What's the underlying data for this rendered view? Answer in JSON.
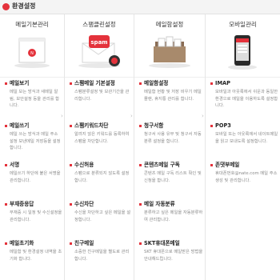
{
  "header": {
    "title": "환경설정"
  },
  "columns": [
    {
      "heading": "메일기본관리",
      "items": [
        {
          "title": "메일보기",
          "desc": "메일 보는 방식과 새메일 알림, 보안설정 등을 관리를 합니다."
        },
        {
          "title": "메일쓰기",
          "desc": "메일 쓰는 방식과 메일 주소 설정 보낸메일 저장등을 설정합니다."
        },
        {
          "title": "서명",
          "desc": "메일쓰기 하단에 붙은 서명을 관리합니다."
        },
        {
          "title": "부재중응답",
          "desc": "부재중 시 일정 및 수신설정을 관리합니다."
        },
        {
          "title": "메일초기화",
          "desc": "메일함 및 환경설정 내역을 초기화 합니다."
        }
      ]
    },
    {
      "heading": "스팸클린설정",
      "badge": "spam",
      "items": [
        {
          "title": "스팸메일 기본설정",
          "desc": "스팸분류설정 및 보관기간을 관리합니다."
        },
        {
          "title": "스팸키워드차단",
          "desc": "알려지 않은 키워드를 등록하여 스팸을 차단합니다."
        },
        {
          "title": "수신허용",
          "desc": "스팸으로 분류되지 않도록 설정합니다."
        },
        {
          "title": "수신차단",
          "desc": "수신을 차단하고 싶은 메일을 설정합니다."
        },
        {
          "title": "친구메일",
          "desc": "소중한 친구메일을 별도로 관리합니다."
        }
      ]
    },
    {
      "heading": "메일함설정",
      "items": [
        {
          "title": "메일함설정",
          "desc": "메일함 현황 및 저장 비우기 메일 플랜, 휴지통 관리를 합니다."
        },
        {
          "title": "청구서함",
          "desc": "청구서 사용 유무 및 청구서 자동분류 설정을 합니다."
        },
        {
          "title": "콘텐츠메일 구독",
          "desc": "콘텐츠 메일 구독 리스트 확인 및 신청을 합니다."
        },
        {
          "title": "메일 자동분류",
          "desc": "분류하고 싶은 메일을 자동분류하여 관리합니다."
        },
        {
          "title": "SKT휴대폰메일",
          "desc": "SKT 휴대폰으로 메일받은 방법을 안내해드립니다."
        }
      ]
    },
    {
      "heading": "모바일관리",
      "items": [
        {
          "title": "IMAP",
          "desc": "모바일과 아웃룩에서 쉬운과 동일한 환경으로 메일을 이용하도록 설정합니다."
        },
        {
          "title": "POP3",
          "desc": "모바일 또는 아웃룩에서 네이트메일을 읽고 보내도록 설정합니다."
        },
        {
          "title": "존댓부메일",
          "desc": "휴대폰번호@nate.com 메일 주소 생성 및 관리합니다."
        }
      ]
    }
  ],
  "colors": {
    "accent": "#e4323b"
  },
  "icons": [
    "letter-icon",
    "spam-envelope-icon",
    "mailbox-icon",
    "smartphone-icon"
  ]
}
